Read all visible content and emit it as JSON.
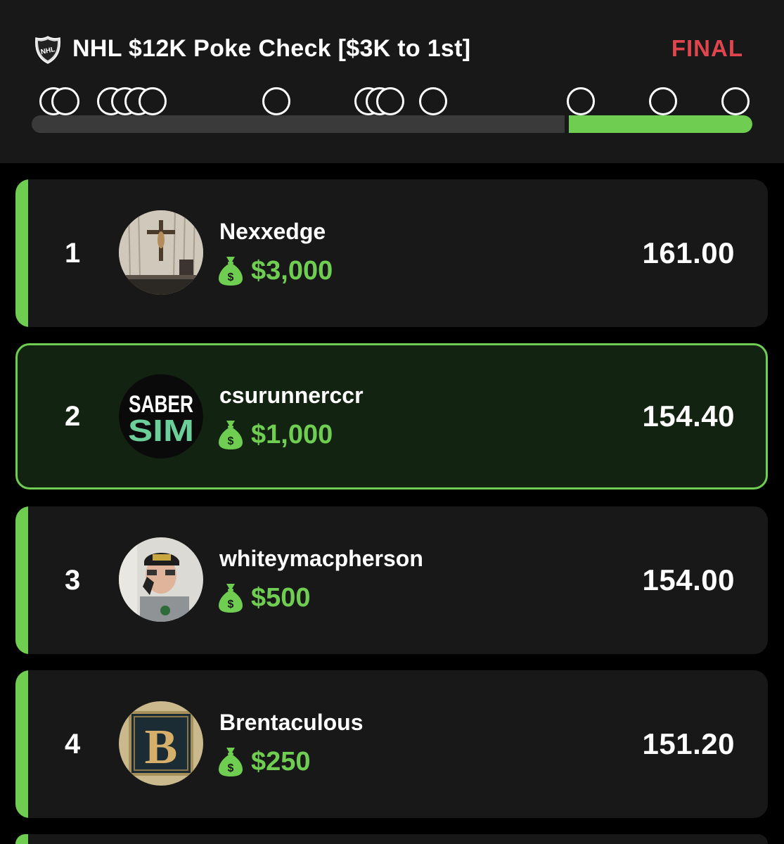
{
  "contest": {
    "title": "NHL $12K Poke Check [$3K to 1st]",
    "status": "FINAL",
    "status_color": "#e0454d",
    "league_logo_text": "NHL",
    "progress": {
      "filled_fraction": 0.255,
      "fill_color": "#6fce52"
    }
  },
  "saber_logo": {
    "line1": "SABER",
    "line2": "SIM"
  },
  "leaderboard": [
    {
      "rank": "1",
      "username": "Nexxedge",
      "prize": "$3,000",
      "score": "161.00",
      "highlighted": false
    },
    {
      "rank": "2",
      "username": "csurunnerccr",
      "prize": "$1,000",
      "score": "154.40",
      "highlighted": true
    },
    {
      "rank": "3",
      "username": "whiteymacpherson",
      "prize": "$500",
      "score": "154.00",
      "highlighted": false
    },
    {
      "rank": "4",
      "username": "Brentaculous",
      "prize": "$250",
      "score": "151.20",
      "highlighted": false
    }
  ],
  "icons": {
    "prize": "money-bag-icon",
    "league": "nhl-shield-icon"
  }
}
